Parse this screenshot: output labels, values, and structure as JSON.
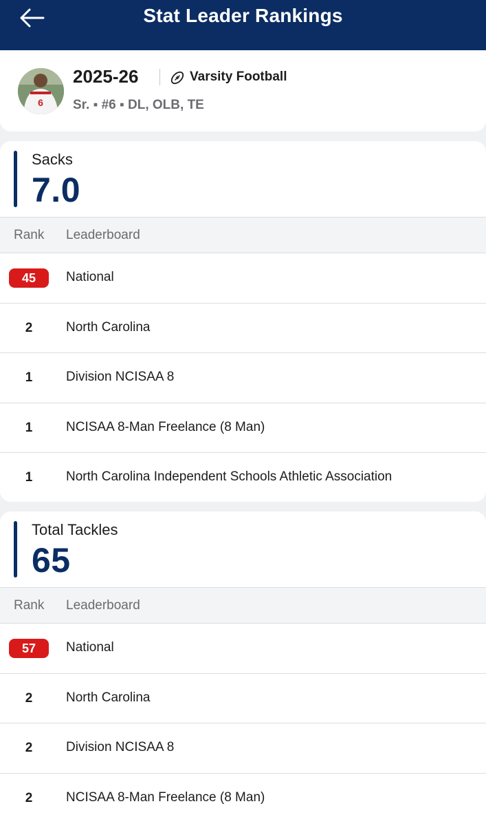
{
  "header": {
    "title": "Stat Leader Rankings"
  },
  "profile": {
    "season": "2025-26",
    "sport": "Varsity Football",
    "meta": "Sr. ▪ #6 ▪ DL, OLB, TE",
    "jersey_number": "6"
  },
  "table_headers": {
    "rank": "Rank",
    "leaderboard": "Leaderboard"
  },
  "stats": [
    {
      "name": "Sacks",
      "value": "7.0",
      "rankings": [
        {
          "rank": "45",
          "board": "National",
          "highlight": true
        },
        {
          "rank": "2",
          "board": "North Carolina",
          "highlight": false
        },
        {
          "rank": "1",
          "board": "Division NCISAA 8",
          "highlight": false
        },
        {
          "rank": "1",
          "board": "NCISAA 8-Man Freelance (8 Man)",
          "highlight": false
        },
        {
          "rank": "1",
          "board": "North Carolina Independent Schools Athletic Association",
          "highlight": false
        }
      ]
    },
    {
      "name": "Total Tackles",
      "value": "65",
      "rankings": [
        {
          "rank": "57",
          "board": "National",
          "highlight": true
        },
        {
          "rank": "2",
          "board": "North Carolina",
          "highlight": false
        },
        {
          "rank": "2",
          "board": "Division NCISAA 8",
          "highlight": false
        },
        {
          "rank": "2",
          "board": "NCISAA 8-Man Freelance (8 Man)",
          "highlight": false
        }
      ]
    }
  ],
  "colors": {
    "navy": "#0b2d63",
    "highlight_red": "#d91a1a",
    "background": "#f0f1f3"
  },
  "icons": {
    "back": "arrow-left-icon",
    "sport": "football-icon"
  }
}
